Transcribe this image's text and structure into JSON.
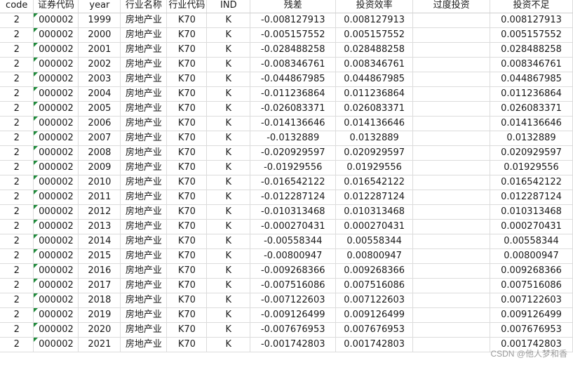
{
  "table": {
    "columns": [
      "code",
      "证券代码",
      "year",
      "行业名称",
      "行业代码",
      "IND",
      "残差",
      "投资效率",
      "过度投资",
      "投资不足"
    ],
    "rows": [
      [
        "2",
        "000002",
        "1999",
        "房地产业",
        "K70",
        "K",
        "-0.008127913",
        "0.008127913",
        "",
        "0.008127913"
      ],
      [
        "2",
        "000002",
        "2000",
        "房地产业",
        "K70",
        "K",
        "-0.005157552",
        "0.005157552",
        "",
        "0.005157552"
      ],
      [
        "2",
        "000002",
        "2001",
        "房地产业",
        "K70",
        "K",
        "-0.028488258",
        "0.028488258",
        "",
        "0.028488258"
      ],
      [
        "2",
        "000002",
        "2002",
        "房地产业",
        "K70",
        "K",
        "-0.008346761",
        "0.008346761",
        "",
        "0.008346761"
      ],
      [
        "2",
        "000002",
        "2003",
        "房地产业",
        "K70",
        "K",
        "-0.044867985",
        "0.044867985",
        "",
        "0.044867985"
      ],
      [
        "2",
        "000002",
        "2004",
        "房地产业",
        "K70",
        "K",
        "-0.011236864",
        "0.011236864",
        "",
        "0.011236864"
      ],
      [
        "2",
        "000002",
        "2005",
        "房地产业",
        "K70",
        "K",
        "-0.026083371",
        "0.026083371",
        "",
        "0.026083371"
      ],
      [
        "2",
        "000002",
        "2006",
        "房地产业",
        "K70",
        "K",
        "-0.014136646",
        "0.014136646",
        "",
        "0.014136646"
      ],
      [
        "2",
        "000002",
        "2007",
        "房地产业",
        "K70",
        "K",
        "-0.0132889",
        "0.0132889",
        "",
        "0.0132889"
      ],
      [
        "2",
        "000002",
        "2008",
        "房地产业",
        "K70",
        "K",
        "-0.020929597",
        "0.020929597",
        "",
        "0.020929597"
      ],
      [
        "2",
        "000002",
        "2009",
        "房地产业",
        "K70",
        "K",
        "-0.01929556",
        "0.01929556",
        "",
        "0.01929556"
      ],
      [
        "2",
        "000002",
        "2010",
        "房地产业",
        "K70",
        "K",
        "-0.016542122",
        "0.016542122",
        "",
        "0.016542122"
      ],
      [
        "2",
        "000002",
        "2011",
        "房地产业",
        "K70",
        "K",
        "-0.012287124",
        "0.012287124",
        "",
        "0.012287124"
      ],
      [
        "2",
        "000002",
        "2012",
        "房地产业",
        "K70",
        "K",
        "-0.010313468",
        "0.010313468",
        "",
        "0.010313468"
      ],
      [
        "2",
        "000002",
        "2013",
        "房地产业",
        "K70",
        "K",
        "-0.000270431",
        "0.000270431",
        "",
        "0.000270431"
      ],
      [
        "2",
        "000002",
        "2014",
        "房地产业",
        "K70",
        "K",
        "-0.00558344",
        "0.00558344",
        "",
        "0.00558344"
      ],
      [
        "2",
        "000002",
        "2015",
        "房地产业",
        "K70",
        "K",
        "-0.00800947",
        "0.00800947",
        "",
        "0.00800947"
      ],
      [
        "2",
        "000002",
        "2016",
        "房地产业",
        "K70",
        "K",
        "-0.009268366",
        "0.009268366",
        "",
        "0.009268366"
      ],
      [
        "2",
        "000002",
        "2017",
        "房地产业",
        "K70",
        "K",
        "-0.007516086",
        "0.007516086",
        "",
        "0.007516086"
      ],
      [
        "2",
        "000002",
        "2018",
        "房地产业",
        "K70",
        "K",
        "-0.007122603",
        "0.007122603",
        "",
        "0.007122603"
      ],
      [
        "2",
        "000002",
        "2019",
        "房地产业",
        "K70",
        "K",
        "-0.009126499",
        "0.009126499",
        "",
        "0.009126499"
      ],
      [
        "2",
        "000002",
        "2020",
        "房地产业",
        "K70",
        "K",
        "-0.007676953",
        "0.007676953",
        "",
        "0.007676953"
      ],
      [
        "2",
        "000002",
        "2021",
        "房地产业",
        "K70",
        "K",
        "-0.001742803",
        "0.001742803",
        "",
        "0.001742803"
      ]
    ],
    "text_marker_color": "#1f8a3b",
    "grid_color": "#dcdcdc"
  },
  "watermark": "CSDN @他人梦和香"
}
